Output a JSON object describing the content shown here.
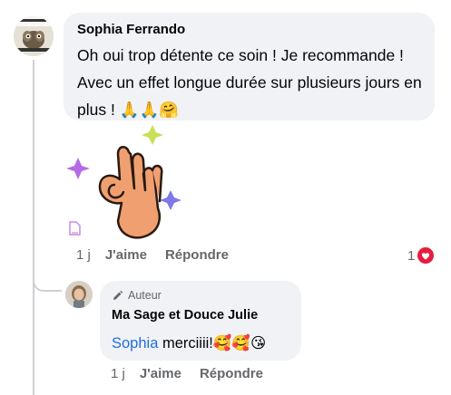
{
  "comment": {
    "author": "Sophia Ferrando",
    "text": "Oh oui trop détente ce soin ! Je recommande ! Avec un effet longue durée sur plusieurs jours en plus ! 🙏🙏🤗",
    "time": "1 j",
    "like_label": "J'aime",
    "reply_label": "Répondre",
    "reaction_count": "1",
    "reaction_icon": "heart-reaction-icon",
    "sticker_icon": "ok-hand-sticker-icon"
  },
  "reply": {
    "badge": "Auteur",
    "badge_icon": "pencil-icon",
    "author": "Ma Sage et Douce Julie",
    "mention": "Sophia",
    "text": " merciiii!🥰🥰😘",
    "time": "1 j",
    "like_label": "J'aime",
    "reply_label": "Répondre"
  },
  "colors": {
    "bubble": "#f0f2f5",
    "mention": "#216fdb",
    "secondary_text": "#65676b",
    "heart": "#e41e3f",
    "hand": "#f0a070",
    "sparkle_purple": "#b66ae6",
    "sparkle_green": "#c9e05a",
    "sparkle_blue": "#7d7ae8"
  }
}
